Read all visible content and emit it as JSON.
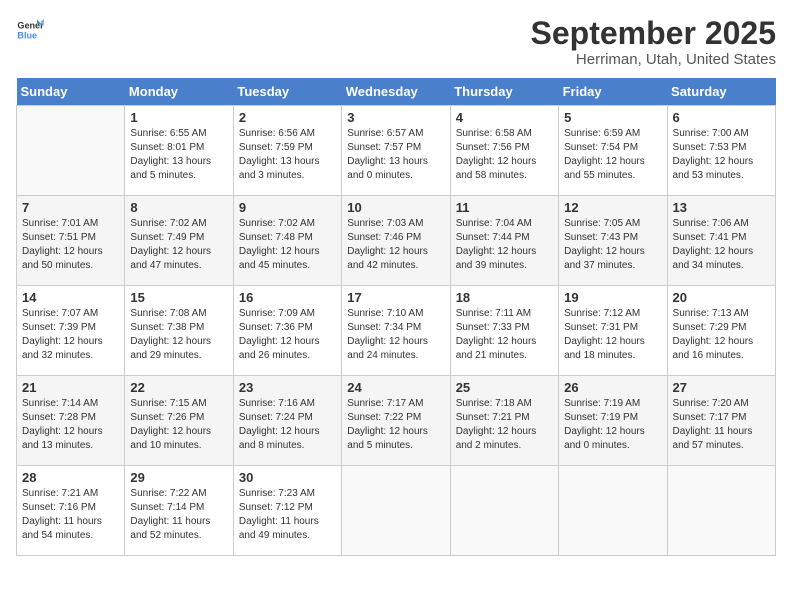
{
  "logo": {
    "general": "General",
    "blue": "Blue"
  },
  "calendar": {
    "title": "September 2025",
    "subtitle": "Herriman, Utah, United States"
  },
  "headers": [
    "Sunday",
    "Monday",
    "Tuesday",
    "Wednesday",
    "Thursday",
    "Friday",
    "Saturday"
  ],
  "weeks": [
    [
      {
        "day": "",
        "info": ""
      },
      {
        "day": "1",
        "info": "Sunrise: 6:55 AM\nSunset: 8:01 PM\nDaylight: 13 hours\nand 5 minutes."
      },
      {
        "day": "2",
        "info": "Sunrise: 6:56 AM\nSunset: 7:59 PM\nDaylight: 13 hours\nand 3 minutes."
      },
      {
        "day": "3",
        "info": "Sunrise: 6:57 AM\nSunset: 7:57 PM\nDaylight: 13 hours\nand 0 minutes."
      },
      {
        "day": "4",
        "info": "Sunrise: 6:58 AM\nSunset: 7:56 PM\nDaylight: 12 hours\nand 58 minutes."
      },
      {
        "day": "5",
        "info": "Sunrise: 6:59 AM\nSunset: 7:54 PM\nDaylight: 12 hours\nand 55 minutes."
      },
      {
        "day": "6",
        "info": "Sunrise: 7:00 AM\nSunset: 7:53 PM\nDaylight: 12 hours\nand 53 minutes."
      }
    ],
    [
      {
        "day": "7",
        "info": "Sunrise: 7:01 AM\nSunset: 7:51 PM\nDaylight: 12 hours\nand 50 minutes."
      },
      {
        "day": "8",
        "info": "Sunrise: 7:02 AM\nSunset: 7:49 PM\nDaylight: 12 hours\nand 47 minutes."
      },
      {
        "day": "9",
        "info": "Sunrise: 7:02 AM\nSunset: 7:48 PM\nDaylight: 12 hours\nand 45 minutes."
      },
      {
        "day": "10",
        "info": "Sunrise: 7:03 AM\nSunset: 7:46 PM\nDaylight: 12 hours\nand 42 minutes."
      },
      {
        "day": "11",
        "info": "Sunrise: 7:04 AM\nSunset: 7:44 PM\nDaylight: 12 hours\nand 39 minutes."
      },
      {
        "day": "12",
        "info": "Sunrise: 7:05 AM\nSunset: 7:43 PM\nDaylight: 12 hours\nand 37 minutes."
      },
      {
        "day": "13",
        "info": "Sunrise: 7:06 AM\nSunset: 7:41 PM\nDaylight: 12 hours\nand 34 minutes."
      }
    ],
    [
      {
        "day": "14",
        "info": "Sunrise: 7:07 AM\nSunset: 7:39 PM\nDaylight: 12 hours\nand 32 minutes."
      },
      {
        "day": "15",
        "info": "Sunrise: 7:08 AM\nSunset: 7:38 PM\nDaylight: 12 hours\nand 29 minutes."
      },
      {
        "day": "16",
        "info": "Sunrise: 7:09 AM\nSunset: 7:36 PM\nDaylight: 12 hours\nand 26 minutes."
      },
      {
        "day": "17",
        "info": "Sunrise: 7:10 AM\nSunset: 7:34 PM\nDaylight: 12 hours\nand 24 minutes."
      },
      {
        "day": "18",
        "info": "Sunrise: 7:11 AM\nSunset: 7:33 PM\nDaylight: 12 hours\nand 21 minutes."
      },
      {
        "day": "19",
        "info": "Sunrise: 7:12 AM\nSunset: 7:31 PM\nDaylight: 12 hours\nand 18 minutes."
      },
      {
        "day": "20",
        "info": "Sunrise: 7:13 AM\nSunset: 7:29 PM\nDaylight: 12 hours\nand 16 minutes."
      }
    ],
    [
      {
        "day": "21",
        "info": "Sunrise: 7:14 AM\nSunset: 7:28 PM\nDaylight: 12 hours\nand 13 minutes."
      },
      {
        "day": "22",
        "info": "Sunrise: 7:15 AM\nSunset: 7:26 PM\nDaylight: 12 hours\nand 10 minutes."
      },
      {
        "day": "23",
        "info": "Sunrise: 7:16 AM\nSunset: 7:24 PM\nDaylight: 12 hours\nand 8 minutes."
      },
      {
        "day": "24",
        "info": "Sunrise: 7:17 AM\nSunset: 7:22 PM\nDaylight: 12 hours\nand 5 minutes."
      },
      {
        "day": "25",
        "info": "Sunrise: 7:18 AM\nSunset: 7:21 PM\nDaylight: 12 hours\nand 2 minutes."
      },
      {
        "day": "26",
        "info": "Sunrise: 7:19 AM\nSunset: 7:19 PM\nDaylight: 12 hours\nand 0 minutes."
      },
      {
        "day": "27",
        "info": "Sunrise: 7:20 AM\nSunset: 7:17 PM\nDaylight: 11 hours\nand 57 minutes."
      }
    ],
    [
      {
        "day": "28",
        "info": "Sunrise: 7:21 AM\nSunset: 7:16 PM\nDaylight: 11 hours\nand 54 minutes."
      },
      {
        "day": "29",
        "info": "Sunrise: 7:22 AM\nSunset: 7:14 PM\nDaylight: 11 hours\nand 52 minutes."
      },
      {
        "day": "30",
        "info": "Sunrise: 7:23 AM\nSunset: 7:12 PM\nDaylight: 11 hours\nand 49 minutes."
      },
      {
        "day": "",
        "info": ""
      },
      {
        "day": "",
        "info": ""
      },
      {
        "day": "",
        "info": ""
      },
      {
        "day": "",
        "info": ""
      }
    ]
  ]
}
